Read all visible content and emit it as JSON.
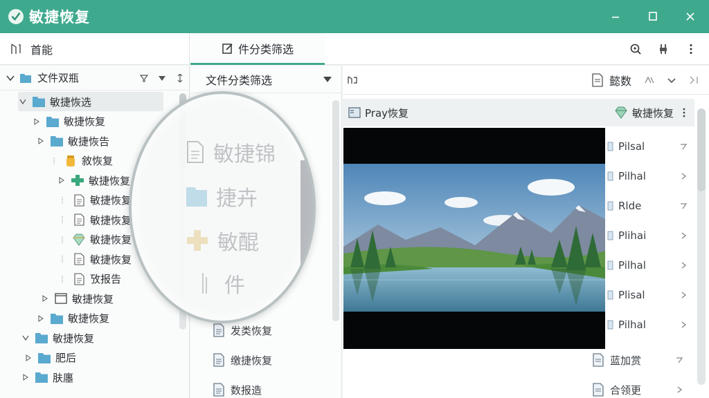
{
  "window": {
    "title": "敏捷恢复",
    "accent": "#3fa98e",
    "controls": [
      "minimize-icon",
      "maximize-icon",
      "close-icon"
    ]
  },
  "toolbar": {
    "home_label": "首能",
    "active_tab": "件分类筛选",
    "actions": [
      "zoom-icon",
      "tools-icon",
      "more-vertical-icon"
    ]
  },
  "tree": {
    "root_label": "文件双瓶",
    "items": [
      {
        "label": "敏捷恢选",
        "icon": "folder-icon",
        "expand": "open",
        "selected": true
      },
      {
        "label": "敏捷恢复",
        "icon": "folder-icon",
        "expand": "closed"
      },
      {
        "label": "敏捷恢告",
        "icon": "folder-icon",
        "expand": "closed"
      },
      {
        "label": "敘恢复",
        "icon": "jar-icon",
        "expand": "none"
      },
      {
        "label": "敏捷恢复",
        "icon": "plus-green-icon",
        "expand": "closed"
      },
      {
        "label": "敏捷恢复",
        "icon": "document-icon",
        "expand": "none"
      },
      {
        "label": "敏捷恢复",
        "icon": "document-icon",
        "expand": "none"
      },
      {
        "label": "敏捷恢复",
        "icon": "gem-icon",
        "expand": "none"
      },
      {
        "label": "敏捷恢复",
        "icon": "document-icon",
        "expand": "none"
      },
      {
        "label": "攷报告",
        "icon": "document-icon",
        "expand": "none"
      },
      {
        "label": "敏捷恢复",
        "icon": "window-icon",
        "expand": "closed"
      },
      {
        "label": "敏捷恢复",
        "icon": "folder-icon",
        "expand": "closed"
      },
      {
        "label": "敏捷恢复",
        "icon": "folder-icon",
        "expand": "open"
      },
      {
        "label": "肥后",
        "icon": "folder-icon",
        "expand": "closed"
      },
      {
        "label": "肤廛",
        "icon": "folder-icon",
        "expand": "closed"
      }
    ]
  },
  "middle": {
    "header": "文件分类筛选",
    "items": [
      "发类恢复",
      "缴捷恢复",
      "数报造"
    ]
  },
  "lens": {
    "rows": [
      "敏捷锦",
      "捷卉",
      "敏醌",
      "件"
    ]
  },
  "right": {
    "summary_label": "懿数",
    "preview_label": "Pray恢复",
    "preview_tag": "敏捷恢复",
    "side_items": [
      "Pilsal",
      "Pilhal",
      "Rlde",
      "Plihai",
      "Pilhal",
      "Plisal",
      "Pilhal"
    ],
    "bottom_items": [
      "蓝加赏",
      "合领更"
    ]
  }
}
